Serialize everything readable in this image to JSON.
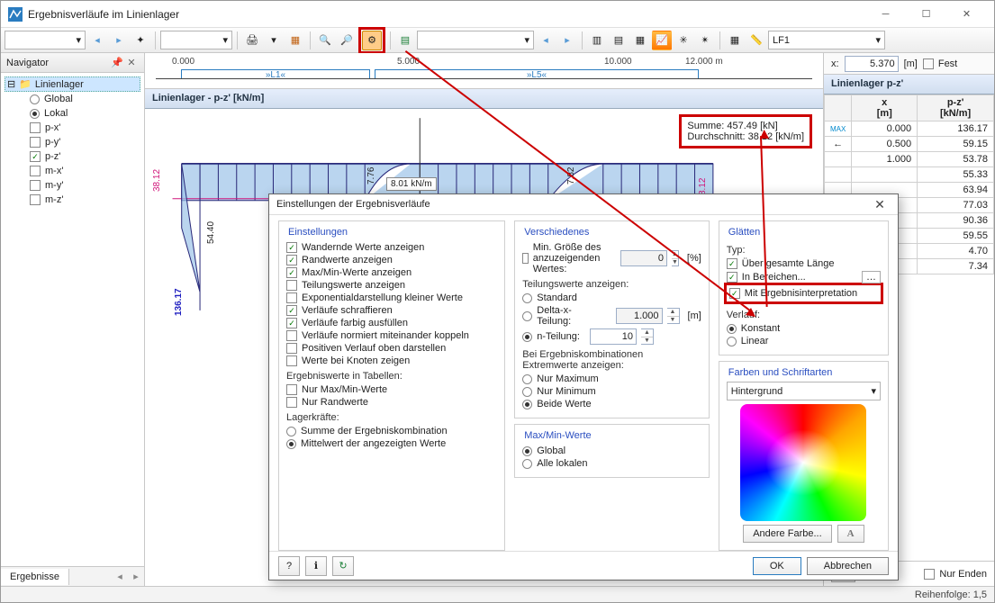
{
  "window_title": "Ergebnisverläufe im Linienlager",
  "navigator": {
    "title": "Navigator",
    "root": "Linienlager",
    "global": "Global",
    "lokal": "Lokal",
    "items": [
      {
        "label": "p-x'",
        "checked": false
      },
      {
        "label": "p-y'",
        "checked": false
      },
      {
        "label": "p-z'",
        "checked": true
      },
      {
        "label": "m-x'",
        "checked": false
      },
      {
        "label": "m-y'",
        "checked": false
      },
      {
        "label": "m-z'",
        "checked": false
      }
    ],
    "tab": "Ergebnisse"
  },
  "toolbar": {
    "lf_combo": "LF1"
  },
  "ruler": {
    "ticks": [
      "0.000",
      "5.000",
      "10.000",
      "12.000 m"
    ],
    "seg1": "»L1«",
    "seg2": "»L5«"
  },
  "pos": {
    "label": "x:",
    "value": "5.370",
    "unit": "[m]",
    "fest": "Fest"
  },
  "plot": {
    "title": "Linienlager - p-z' [kN/m]",
    "sum": "Summe: 457.49 [kN]",
    "avg": "Durchschnitt: 38.12 [kN/m]",
    "val_center": "8.01 kN/m",
    "val1": "7.76",
    "val2": "7.82",
    "left_axis_1": "38.12",
    "left_axis_2": "54.40",
    "left_axis_3": "136.17",
    "right_axis": "8.12"
  },
  "rtable": {
    "title": "Linienlager p-z'",
    "h1": "x\n[m]",
    "h2": "p-z'\n[kN/m]",
    "rows": [
      {
        "x": "0.000",
        "v": "136.17"
      },
      {
        "x": "0.500",
        "v": "59.15"
      },
      {
        "x": "1.000",
        "v": "53.78"
      },
      {
        "x": "",
        "v": "55.33"
      },
      {
        "x": "",
        "v": "63.94"
      },
      {
        "x": "",
        "v": "77.03"
      },
      {
        "x": "",
        "v": "90.36"
      },
      {
        "x": "",
        "v": "59.55"
      },
      {
        "x": "",
        "v": "4.70"
      },
      {
        "x": "",
        "v": "7.34"
      }
    ],
    "btn_arrows": "⇆",
    "nur_enden": "Nur Enden"
  },
  "dialog": {
    "title": "Einstellungen der Ergebnisverläufe",
    "g1": "Einstellungen",
    "c1": "Wandernde Werte anzeigen",
    "c2": "Randwerte anzeigen",
    "c3": "Max/Min-Werte anzeigen",
    "c4": "Teilungswerte anzeigen",
    "c5": "Exponentialdarstellung kleiner Werte",
    "c6": "Verläufe schraffieren",
    "c7": "Verläufe farbig ausfüllen",
    "c8": "Verläufe normiert miteinander koppeln",
    "c9": "Positiven Verlauf oben darstellen",
    "c10": "Werte bei  Knoten zeigen",
    "sub1": "Ergebniswerte in Tabellen:",
    "c11": "Nur Max/Min-Werte",
    "c12": "Nur Randwerte",
    "sub2": "Lagerkräfte:",
    "r1": "Summe der Ergebniskombination",
    "r2": "Mittelwert der angezeigten Werte",
    "g2": "Verschiedenes",
    "c13": "Min. Größe des anzuzeigenden Wertes:",
    "pct": "[%]",
    "pct_val": "0",
    "sub3": "Teilungswerte anzeigen:",
    "r3": "Standard",
    "r4": "Delta-x-Teilung:",
    "r5": "n-Teilung:",
    "dx": "1.000",
    "dx_u": "[m]",
    "n": "10",
    "sub4": "Bei Ergebniskombinationen Extremwerte anzeigen:",
    "r6": "Nur Maximum",
    "r7": "Nur Minimum",
    "r8": "Beide Werte",
    "g3": "Max/Min-Werte",
    "r9": "Global",
    "r10": "Alle lokalen",
    "g4": "Glätten",
    "typ": "Typ:",
    "c14": "Über gesamte Länge",
    "c15": "In Bereichen...",
    "c16": "Mit Ergebnisinterpretation",
    "verlauf": "Verlauf:",
    "r11": "Konstant",
    "r12": "Linear",
    "g5": "Farben und Schriftarten",
    "combo": "Hintergrund",
    "andere": "Andere Farbe...",
    "ok": "OK",
    "cancel": "Abbrechen"
  },
  "status": "Reihenfolge:  1,5"
}
